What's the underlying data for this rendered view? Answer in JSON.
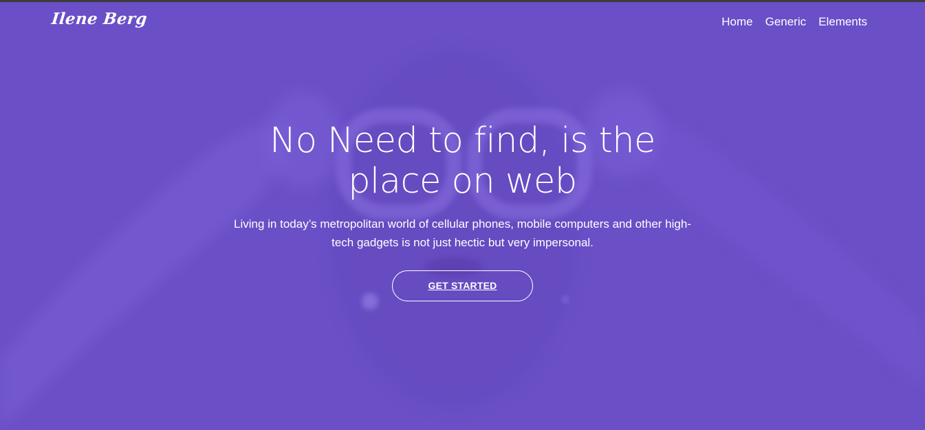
{
  "brand": {
    "logo_text": "Ilene Berg"
  },
  "nav": {
    "items": [
      {
        "label": "Home"
      },
      {
        "label": "Generic"
      },
      {
        "label": "Elements"
      }
    ]
  },
  "hero": {
    "title": "No Need to find, is the place on web",
    "text": "Living in today’s metropolitan world of cellular phones, mobile computers and other high-tech gadgets is not just hectic but very impersonal.",
    "cta_label": "GET STARTED",
    "overlay_color": "#6a4fc7"
  }
}
